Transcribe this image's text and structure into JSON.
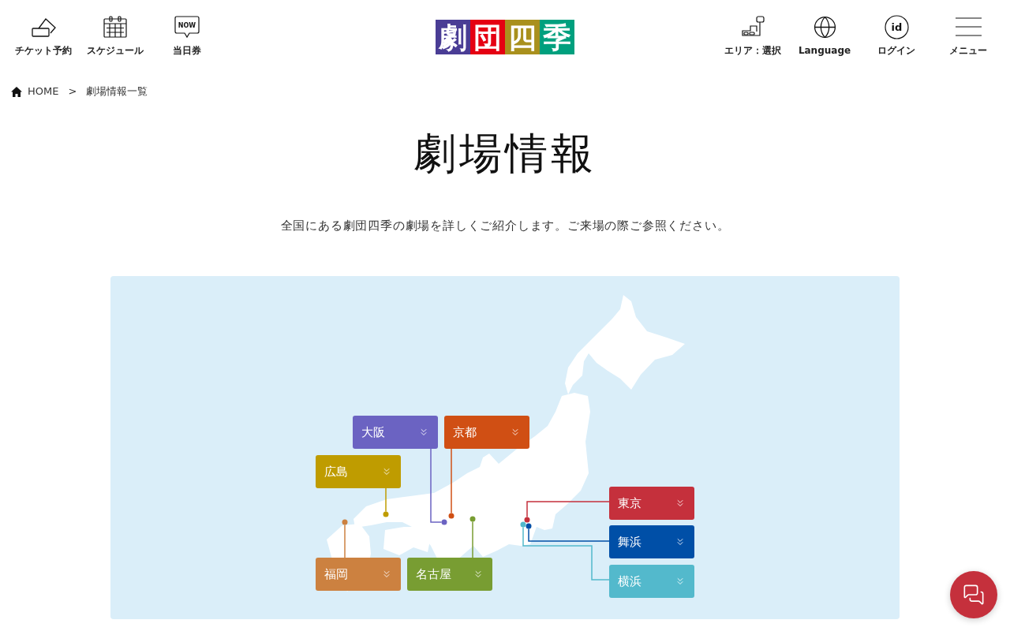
{
  "header": {
    "left_nav": [
      {
        "label": "チケット予約"
      },
      {
        "label": "スケジュール"
      },
      {
        "label": "当日券",
        "badge": "NOW"
      }
    ],
    "logo": [
      {
        "text": "劇",
        "color": "#4a3d95"
      },
      {
        "text": "団",
        "color": "#e50012"
      },
      {
        "text": "四",
        "color": "#a9901d"
      },
      {
        "text": "季",
        "color": "#00a07e"
      }
    ],
    "right_nav": [
      {
        "label": "エリア：選択"
      },
      {
        "label": "Language"
      },
      {
        "label": "ログイン",
        "badge": "id"
      },
      {
        "label": "メニュー"
      }
    ]
  },
  "breadcrumb": {
    "items": [
      {
        "label": "HOME"
      },
      {
        "label": "劇場情報一覧"
      }
    ],
    "separator": ">"
  },
  "page_title": "劇場情報",
  "intro": "全国にある劇団四季の劇場を詳しくご紹介します。ご来場の際ご参照ください。",
  "map": {
    "regions": [
      {
        "label": "大阪",
        "color": "#6b63c2"
      },
      {
        "label": "京都",
        "color": "#d04f14"
      },
      {
        "label": "広島",
        "color": "#bf9c00"
      },
      {
        "label": "福岡",
        "color": "#cc8140"
      },
      {
        "label": "名古屋",
        "color": "#789d32"
      },
      {
        "label": "東京",
        "color": "#c5303c"
      },
      {
        "label": "舞浜",
        "color": "#004fa7"
      },
      {
        "label": "横浜",
        "color": "#53b9cc"
      }
    ]
  }
}
